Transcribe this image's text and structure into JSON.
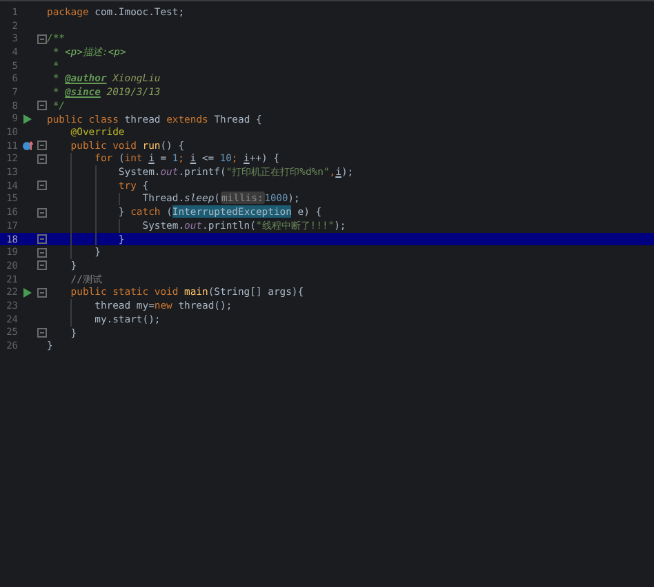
{
  "editor": {
    "lines": [
      {
        "number": "1",
        "runnable": false,
        "overrides": false,
        "fold": false,
        "selected": false,
        "tokens": [
          {
            "text": "package",
            "kind": "kw"
          },
          {
            "text": " com.Imooc.Test;",
            "kind": "plain"
          }
        ]
      },
      {
        "number": "2",
        "runnable": false,
        "overrides": false,
        "fold": false,
        "selected": false
      },
      {
        "number": "3",
        "runnable": false,
        "overrides": false,
        "fold": true,
        "selected": false,
        "tokens": [
          {
            "text": "/**",
            "kind": "doc"
          }
        ]
      },
      {
        "number": "4",
        "runnable": false,
        "overrides": false,
        "fold": false,
        "selected": false,
        "tokens": [
          {
            "text": " * ",
            "kind": "doc"
          },
          {
            "text": "<p>",
            "kind": "doctag"
          },
          {
            "text": "描述:",
            "kind": "doc"
          },
          {
            "text": "<p>",
            "kind": "doctag"
          }
        ]
      },
      {
        "number": "5",
        "runnable": false,
        "overrides": false,
        "fold": false,
        "selected": false,
        "tokens": [
          {
            "text": " *",
            "kind": "doc"
          }
        ]
      },
      {
        "number": "6",
        "runnable": false,
        "overrides": false,
        "fold": false,
        "selected": false,
        "tokens": [
          {
            "text": " * ",
            "kind": "doc"
          },
          {
            "text": "@author",
            "kind": "doctagname"
          },
          {
            "text": " XiongLiu",
            "kind": "docvalue"
          }
        ]
      },
      {
        "number": "7",
        "runnable": false,
        "overrides": false,
        "fold": false,
        "selected": false,
        "tokens": [
          {
            "text": " * ",
            "kind": "doc"
          },
          {
            "text": "@since",
            "kind": "doctagname"
          },
          {
            "text": " 2019/3/13",
            "kind": "docvalue"
          }
        ]
      },
      {
        "number": "8",
        "runnable": false,
        "overrides": false,
        "fold": true,
        "selected": false,
        "tokens": [
          {
            "text": " */",
            "kind": "doc"
          }
        ]
      },
      {
        "number": "9",
        "runnable": true,
        "overrides": false,
        "fold": false,
        "selected": false,
        "tokens": [
          {
            "text": "public class ",
            "kind": "kw"
          },
          {
            "text": "thread ",
            "kind": "plain"
          },
          {
            "text": "extends ",
            "kind": "kw"
          },
          {
            "text": "Thread {",
            "kind": "plain"
          }
        ]
      },
      {
        "number": "10",
        "runnable": false,
        "overrides": false,
        "fold": false,
        "selected": false,
        "tokens": [
          {
            "text": "    @Override",
            "kind": "annotation"
          }
        ]
      },
      {
        "number": "11",
        "runnable": false,
        "overrides": true,
        "fold": true,
        "selected": false,
        "tokens": [
          {
            "text": "    public void ",
            "kind": "kw"
          },
          {
            "text": "run",
            "kind": "method"
          },
          {
            "text": "() {",
            "kind": "plain"
          }
        ]
      },
      {
        "number": "12",
        "runnable": false,
        "overrides": false,
        "fold": true,
        "selected": false,
        "tokens": [
          {
            "text": "        for ",
            "kind": "kw"
          },
          {
            "text": "(",
            "kind": "plain"
          },
          {
            "text": "int ",
            "kind": "kw"
          },
          {
            "text": "i",
            "kind": "var"
          },
          {
            "text": " = ",
            "kind": "plain"
          },
          {
            "text": "1",
            "kind": "num"
          },
          {
            "text": "; ",
            "kind": "kw"
          },
          {
            "text": "i",
            "kind": "var"
          },
          {
            "text": " <= ",
            "kind": "plain"
          },
          {
            "text": "10",
            "kind": "num"
          },
          {
            "text": "; ",
            "kind": "kw"
          },
          {
            "text": "i",
            "kind": "var"
          },
          {
            "text": "++) {",
            "kind": "plain"
          }
        ]
      },
      {
        "number": "13",
        "runnable": false,
        "overrides": false,
        "fold": false,
        "selected": false,
        "tokens": [
          {
            "text": "            System.",
            "kind": "plain"
          },
          {
            "text": "out",
            "kind": "field"
          },
          {
            "text": ".printf(",
            "kind": "plain"
          },
          {
            "text": "\"打印机正在打印%d%n\"",
            "kind": "str"
          },
          {
            "text": ",",
            "kind": "kw"
          },
          {
            "text": "i",
            "kind": "var"
          },
          {
            "text": ");",
            "kind": "plain"
          }
        ]
      },
      {
        "number": "14",
        "runnable": false,
        "overrides": false,
        "fold": true,
        "selected": false,
        "tokens": [
          {
            "text": "            try ",
            "kind": "kw"
          },
          {
            "text": "{",
            "kind": "plain"
          }
        ]
      },
      {
        "number": "15",
        "runnable": false,
        "overrides": false,
        "fold": false,
        "selected": false,
        "tokens": [
          {
            "text": "                Thread.",
            "kind": "plain"
          },
          {
            "text": "sleep",
            "kind": "static"
          },
          {
            "text": "(",
            "kind": "plain"
          },
          {
            "text": "millis:",
            "kind": "hint"
          },
          {
            "text": "1000",
            "kind": "num"
          },
          {
            "text": ");",
            "kind": "plain"
          }
        ]
      },
      {
        "number": "16",
        "runnable": false,
        "overrides": false,
        "fold": true,
        "selected": false,
        "tokens": [
          {
            "text": "            } ",
            "kind": "plain"
          },
          {
            "text": "catch ",
            "kind": "kw"
          },
          {
            "text": "(",
            "kind": "plain"
          },
          {
            "text": "InterruptedException",
            "kind": "highlight"
          },
          {
            "text": " e) {",
            "kind": "plain"
          }
        ]
      },
      {
        "number": "17",
        "runnable": false,
        "overrides": false,
        "fold": false,
        "selected": false,
        "tokens": [
          {
            "text": "                System.",
            "kind": "plain"
          },
          {
            "text": "out",
            "kind": "field"
          },
          {
            "text": ".println(",
            "kind": "plain"
          },
          {
            "text": "\"线程中断了!!!\"",
            "kind": "str"
          },
          {
            "text": ");",
            "kind": "plain"
          }
        ]
      },
      {
        "number": "18",
        "runnable": false,
        "overrides": false,
        "fold": true,
        "selected": true,
        "tokens": [
          {
            "text": "            }",
            "kind": "plain"
          }
        ]
      },
      {
        "number": "19",
        "runnable": false,
        "overrides": false,
        "fold": true,
        "selected": false,
        "tokens": [
          {
            "text": "        }",
            "kind": "plain"
          }
        ]
      },
      {
        "number": "20",
        "runnable": false,
        "overrides": false,
        "fold": true,
        "selected": false,
        "tokens": [
          {
            "text": "    }",
            "kind": "plain"
          }
        ]
      },
      {
        "number": "21",
        "runnable": false,
        "overrides": false,
        "fold": false,
        "selected": false,
        "tokens": [
          {
            "text": "    //测试",
            "kind": "comment"
          }
        ]
      },
      {
        "number": "22",
        "runnable": true,
        "overrides": false,
        "fold": true,
        "selected": false,
        "tokens": [
          {
            "text": "    public static void ",
            "kind": "kw"
          },
          {
            "text": "main",
            "kind": "method"
          },
          {
            "text": "(String[] args){",
            "kind": "plain"
          }
        ]
      },
      {
        "number": "23",
        "runnable": false,
        "overrides": false,
        "fold": false,
        "selected": false,
        "tokens": [
          {
            "text": "        thread my=",
            "kind": "plain"
          },
          {
            "text": "new ",
            "kind": "kw"
          },
          {
            "text": "thread();",
            "kind": "plain"
          }
        ]
      },
      {
        "number": "24",
        "runnable": false,
        "overrides": false,
        "fold": false,
        "selected": false,
        "tokens": [
          {
            "text": "        my.start();",
            "kind": "plain"
          }
        ]
      },
      {
        "number": "25",
        "runnable": false,
        "overrides": false,
        "fold": true,
        "selected": false,
        "tokens": [
          {
            "text": "    }",
            "kind": "plain"
          }
        ]
      },
      {
        "number": "26",
        "runnable": false,
        "overrides": false,
        "fold": false,
        "selected": false,
        "tokens": [
          {
            "text": "}",
            "kind": "plain"
          }
        ]
      }
    ]
  }
}
